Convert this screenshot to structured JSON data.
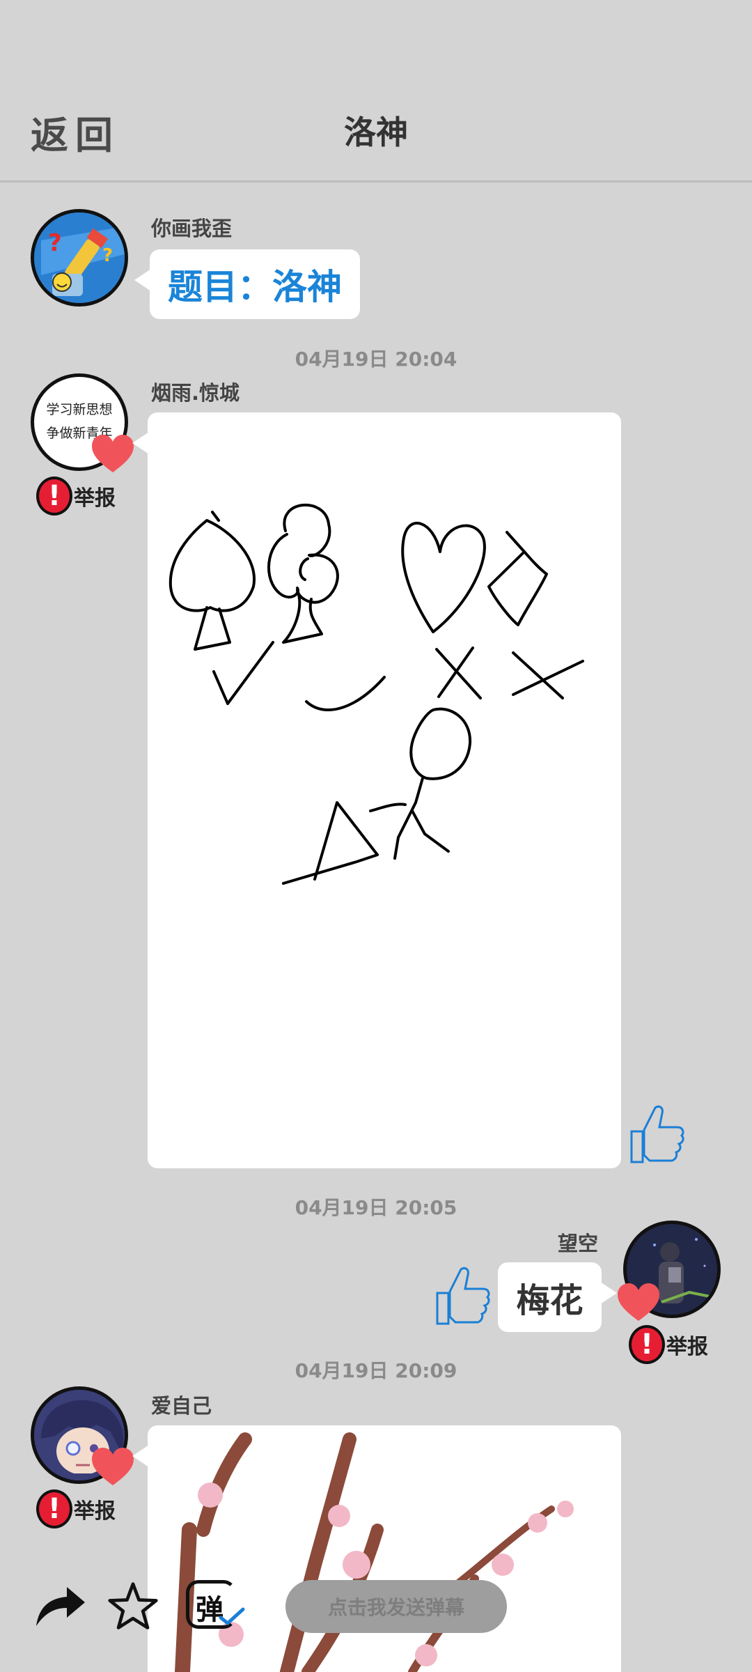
{
  "header": {
    "back_label": "返回",
    "title": "洛神"
  },
  "messages": [
    {
      "username": "你画我歪",
      "topic": "题目：洛神"
    },
    {
      "timestamp": "04月19日  20:04",
      "username": "烟雨.惊城",
      "avatar_text_line1": "学习新思想",
      "avatar_text_line2": "争做新青年",
      "report_label": "举报"
    },
    {
      "timestamp": "04月19日  20:05",
      "username": "望空",
      "answer": "梅花",
      "report_label": "举报"
    },
    {
      "timestamp": "04月19日  20:09",
      "username": "爱自己",
      "report_label": "举报"
    }
  ],
  "bottom_bar": {
    "barrage_glyph": "弹",
    "barrage_placeholder": "点击我发送弹幕"
  },
  "colors": {
    "background": "#d4d4d4",
    "topic_blue": "#1a84d8",
    "heart_red": "#f0545a",
    "report_red": "#e61e33",
    "thumb_blue": "#1a7fd6"
  },
  "icons": [
    "share-icon",
    "star-icon",
    "barrage-icon",
    "heart-icon",
    "report-icon",
    "thumbs-up-icon"
  ]
}
